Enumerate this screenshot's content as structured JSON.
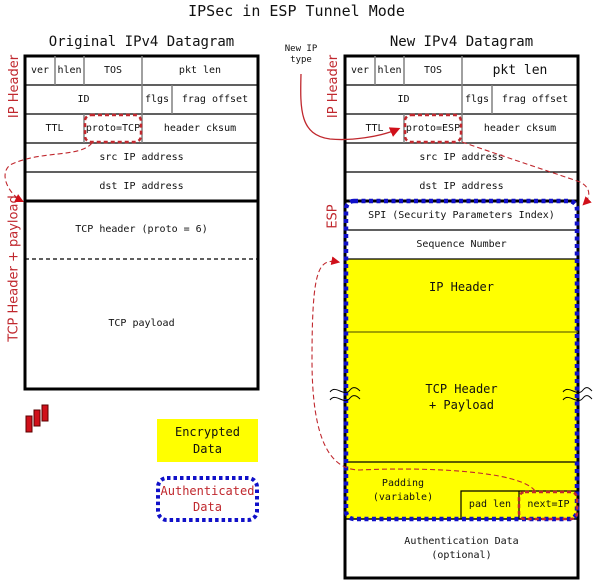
{
  "title": "IPSec in ESP Tunnel Mode",
  "colors": {
    "red_label": "#c0282e",
    "encrypted_fill": "#ffff00",
    "auth_border": "#1010c8",
    "frame": "#000000",
    "inner_line": "#808080"
  },
  "original": {
    "heading": "Original IPv4 Datagram",
    "side_labels": {
      "ip_header": "IP Header",
      "tcp": "TCP Header + payload"
    },
    "row1": {
      "ver": "ver",
      "hlen": "hlen",
      "tos": "TOS",
      "pkt_len": "pkt len"
    },
    "row2": {
      "id": "ID",
      "flgs": "flgs",
      "frag": "frag offset"
    },
    "row3": {
      "ttl": "TTL",
      "proto": "proto=TCP",
      "cksum": "header cksum"
    },
    "src": "src IP address",
    "dst": "dst IP address",
    "tcp_header": "TCP header (proto = 6)",
    "tcp_payload": "TCP payload"
  },
  "new": {
    "heading": "New IPv4 Datagram",
    "annotation": "New IP type",
    "side_labels": {
      "ip_header": "IP Header",
      "esp": "ESP"
    },
    "row1": {
      "ver": "ver",
      "hlen": "hlen",
      "tos": "TOS",
      "pkt_len": "pkt len"
    },
    "row2": {
      "id": "ID",
      "flgs": "flgs",
      "frag": "frag offset"
    },
    "row3": {
      "ttl": "TTL",
      "proto": "proto=ESP",
      "cksum": "header cksum"
    },
    "src": "src IP address",
    "dst": "dst IP address",
    "spi": "SPI (Security Parameters Index)",
    "seq": "Sequence Number",
    "inner_ip": "IP Header",
    "inner_tcp_1": "TCP Header",
    "inner_tcp_2": "+ Payload",
    "padding_1": "Padding",
    "padding_2": "(variable)",
    "pad_len": "pad len",
    "next": "next=IP",
    "auth_1": "Authentication Data",
    "auth_2": "(optional)"
  },
  "legend": {
    "encrypted_1": "Encrypted",
    "encrypted_2": "Data",
    "authenticated_1": "Authenticated",
    "authenticated_2": "Data"
  }
}
